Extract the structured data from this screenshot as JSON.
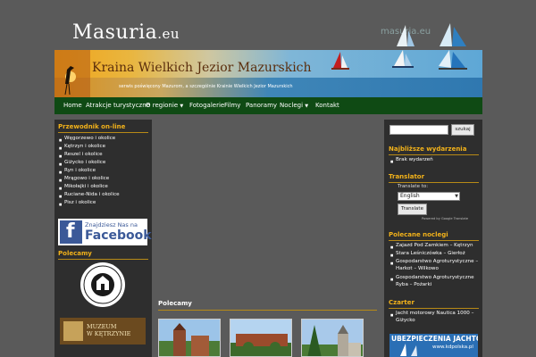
{
  "header": {
    "site_name": "Masuria",
    "site_tld": ".eu",
    "mark": "masuria.eu"
  },
  "banner": {
    "title": "Kraina Wielkich Jezior Mazurskich",
    "subtitle": "serwis poświęcony Mazurom, a szczególnie Krainie Wielkich Jezior Mazurskich"
  },
  "nav": {
    "items": [
      "Home",
      "Atrakcje turystyczne",
      "O regionie",
      "Fotogalerie",
      "Filmy",
      "Panoramy",
      "Noclegi",
      "Kontakt"
    ]
  },
  "left": {
    "guide_heading": "Przewodnik on-line",
    "guide_items": [
      "Węgorzewo i okolice",
      "Kętrzyn i okolice",
      "Reszel i okolice",
      "Giżycko i okolice",
      "Ryn i okolice",
      "Mrągowo i okolice",
      "Mikołajki i okolice",
      "Ruciane-Nida i okolice",
      "Pisz i okolice"
    ],
    "facebook_line1": "Znajdziesz Nas na",
    "facebook_line2": "Facebook",
    "recommend_heading": "Polecamy",
    "museum_label": "MUZEUM\nW KĘTRZYNIE"
  },
  "center": {
    "heading": "Polecamy"
  },
  "right": {
    "search_button": "szukaj",
    "events_heading": "Najbliższe wydarzenia",
    "events_items": [
      "Brak wydarzeń"
    ],
    "translator_heading": "Translator",
    "translate_to": "Translate to:",
    "language": "English",
    "translate_button": "Translate",
    "powered": "Powered by Google Translate",
    "lodging_heading": "Polecane noclegi",
    "lodging_items": [
      "Zajazd Pod Zamkiem – Kętrzyn",
      "Stara Leśniczówka – Gierłoż",
      "Gospodarstwo Agroturystyczne –",
      "Harkot – Wilkowo",
      "Gospodarstwo Agroturystyczne",
      "Ryba – Pożarki"
    ],
    "charter_heading": "Czarter",
    "charter_items": [
      "Jacht motorowy Nautica 1000 –",
      "Giżycko"
    ],
    "insurance_banner": "UBEZPIECZENIA JACHTÓW",
    "insurance_url": "www.kdpolska.pl"
  }
}
